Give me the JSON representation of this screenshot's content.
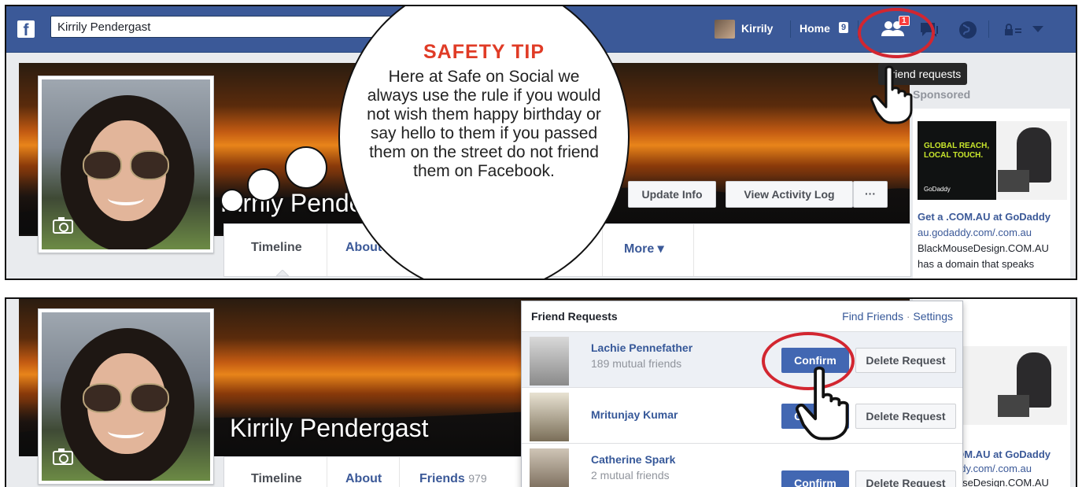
{
  "fb_bar": {
    "logo": "f",
    "search_value": "Kirrily Pendergast",
    "user_name": "Kirrily",
    "home_label": "Home",
    "home_count": "9",
    "friend_requests_badge": "1"
  },
  "tooltip": "Friend requests",
  "sponsored_label": "Sponsored",
  "profile": {
    "cover_name": "Kirrily Pendergast",
    "update_info": "Update Info",
    "view_activity_log": "View Activity Log",
    "more_dots": "···",
    "tabs": {
      "timeline": "Timeline",
      "about": "About",
      "friends": "Friends",
      "friends_count": "979",
      "more": "More ▾"
    }
  },
  "safety_tip": {
    "title": "SAFETY TIP",
    "body": "Here at Safe on Social we always use the rule if you would not wish them happy birthday or say hello to them if you passed them on the street do not friend them on Facebook."
  },
  "ad": {
    "banner_line1": "GLOBAL REACH,",
    "banner_line2": "LOCAL TOUCH.",
    "banner_logo": "GoDaddy",
    "title": "Get a .COM.AU at GoDaddy",
    "url": "au.godaddy.com/.com.au",
    "text1": "BlackMouseDesign.COM.AU",
    "text2": "has a domain that speaks"
  },
  "friend_requests": {
    "header": "Friend Requests",
    "find_friends": "Find Friends",
    "separator": "·",
    "settings": "Settings",
    "confirm_label": "Confirm",
    "delete_label": "Delete Request",
    "items": [
      {
        "name": "Lachie Pennefather",
        "mutual": "189 mutual friends"
      },
      {
        "name": "Mritunjay Kumar",
        "mutual": ""
      },
      {
        "name": "Catherine Spark",
        "mutual": "2 mutual friends"
      }
    ]
  },
  "colors": {
    "facebook_blue": "#3b5998",
    "confirm_blue": "#4267b2",
    "highlight_red": "#d22630",
    "tip_title": "#e03b26"
  },
  "icons": [
    "facebook-logo-icon",
    "friends-icon",
    "messages-icon",
    "globe-icon",
    "privacy-lock-icon",
    "chevron-down-icon",
    "camera-icon",
    "pointer-hand-icon"
  ]
}
